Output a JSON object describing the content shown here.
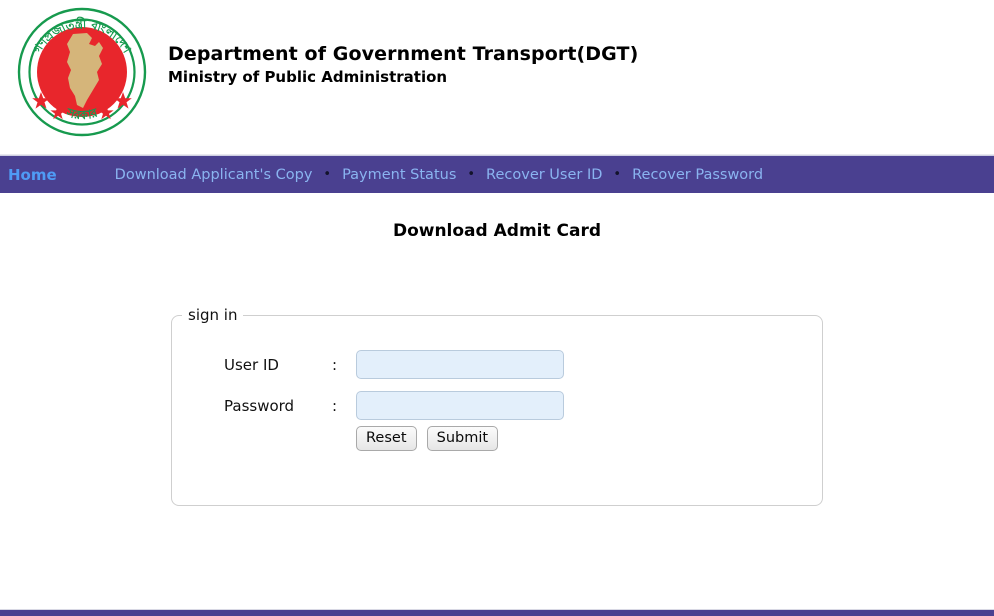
{
  "header": {
    "logo": {
      "icon_name": "bangladesh-government-emblem",
      "top_arc_text": "গণপ্রজাতন্ত্রী বাংলাদেশ",
      "bottom_arc_text": "সরকার",
      "colors": {
        "ring": "#179a4e",
        "disc": "#e8262c",
        "map": "#d5b57a",
        "star": "#e8262c"
      }
    },
    "title": "Department of Government Transport(DGT)",
    "subtitle": "Ministry of Public Administration"
  },
  "nav": {
    "background": "#4a4090",
    "home": {
      "label": "Home",
      "color": "#4f9bf5"
    },
    "separator": "•",
    "links": [
      {
        "label": "Download Applicant's Copy"
      },
      {
        "label": "Payment Status"
      },
      {
        "label": "Recover User ID"
      },
      {
        "label": "Recover Password"
      }
    ]
  },
  "main": {
    "page_title": "Download Admit Card",
    "form": {
      "legend": "sign in",
      "fields": [
        {
          "label": "User ID",
          "colon": ":",
          "value": "",
          "placeholder": ""
        },
        {
          "label": "Password",
          "colon": ":",
          "value": "",
          "placeholder": ""
        }
      ],
      "buttons": [
        {
          "label": "Reset"
        },
        {
          "label": "Submit"
        }
      ]
    }
  }
}
